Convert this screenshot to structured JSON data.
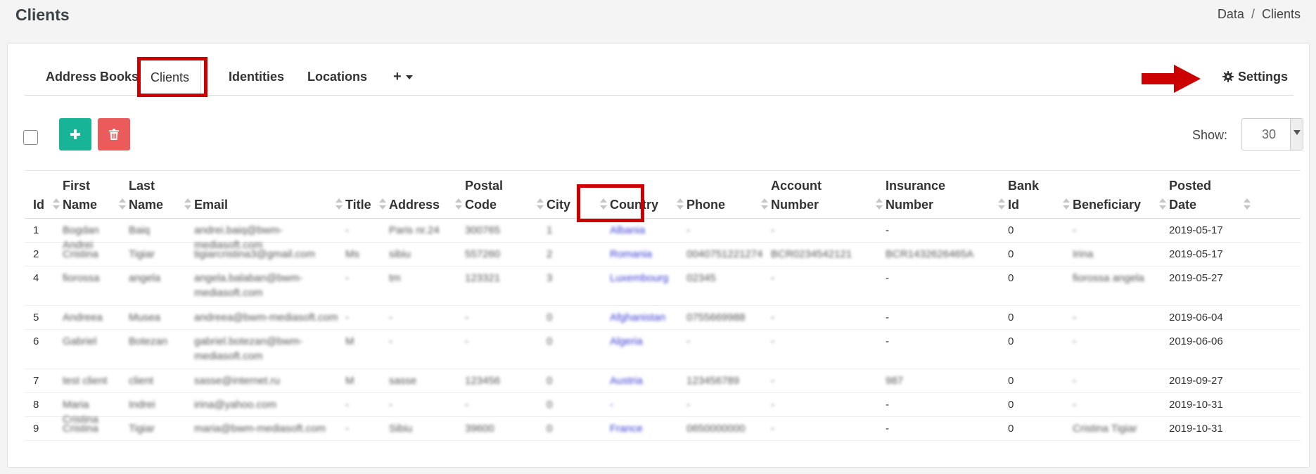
{
  "page": {
    "title": "Clients",
    "breadcrumb": [
      "Data",
      "Clients"
    ],
    "breadcrumb_sep": "/"
  },
  "tabs": [
    {
      "label": "Address Books",
      "active": false
    },
    {
      "label": "Clients",
      "active": true
    },
    {
      "label": "Identities",
      "active": false
    },
    {
      "label": "Locations",
      "active": false
    }
  ],
  "tab_add_label": "+",
  "settings_label": "Settings",
  "toolbar": {
    "show_label": "Show:",
    "show_value": "30"
  },
  "colors": {
    "add_button": "#17b498",
    "delete_button": "#ec5b5b",
    "annotation": "#cc0000",
    "link": "#3b3bd4"
  },
  "table": {
    "columns": [
      {
        "key": "id",
        "label": "Id"
      },
      {
        "key": "first_name",
        "label": "First\nName"
      },
      {
        "key": "last_name",
        "label": "Last\nName"
      },
      {
        "key": "email",
        "label": "Email"
      },
      {
        "key": "title",
        "label": "Title"
      },
      {
        "key": "address",
        "label": "Address"
      },
      {
        "key": "postal_code",
        "label": "Postal\nCode"
      },
      {
        "key": "city",
        "label": "City"
      },
      {
        "key": "country",
        "label": "Country"
      },
      {
        "key": "phone",
        "label": "Phone"
      },
      {
        "key": "account_number",
        "label": "Account\nNumber"
      },
      {
        "key": "insurance_number",
        "label": "Insurance\nNumber"
      },
      {
        "key": "bank_id",
        "label": "Bank\nId"
      },
      {
        "key": "beneficiary",
        "label": "Beneficiary"
      },
      {
        "key": "posted_date",
        "label": "Posted\nDate"
      }
    ],
    "rows": [
      {
        "id": "1",
        "first_name": "Bogdan Andrei",
        "last_name": "Baiq",
        "email": "andrei.baiq@bwm-mediasoft.com",
        "title": "-",
        "address": "Paris nr.24",
        "postal_code": "300765",
        "city": "1",
        "country": "Albania",
        "phone": "-",
        "account_number": "-",
        "insurance_number": "-",
        "bank_id": "0",
        "beneficiary": "-",
        "posted_date": "2019-05-17"
      },
      {
        "id": "2",
        "first_name": "Cristina",
        "last_name": "Tigiar",
        "email": "tigiarcristina3@gmail.com",
        "title": "Ms",
        "address": "sibiu",
        "postal_code": "557260",
        "city": "2",
        "country": "Romania",
        "phone": "0040751221274",
        "account_number": "BCR0234542121",
        "insurance_number": "BCR1432626465A",
        "bank_id": "0",
        "beneficiary": "Irina",
        "posted_date": "2019-05-17"
      },
      {
        "id": "4",
        "first_name": "fiorossa",
        "last_name": "angela",
        "email": "angela.balaban@bwm-mediasoft.com",
        "title": "-",
        "address": "tm",
        "postal_code": "123321",
        "city": "3",
        "country": "Luxembourg",
        "phone": "02345",
        "account_number": "-",
        "insurance_number": "-",
        "bank_id": "0",
        "beneficiary": "fiorossa angela",
        "posted_date": "2019-05-27"
      },
      {
        "id": "5",
        "first_name": "Andreea",
        "last_name": "Musea",
        "email": "andreea@bwm-mediasoft.com",
        "title": "-",
        "address": "-",
        "postal_code": "-",
        "city": "0",
        "country": "Afghanistan",
        "phone": "0755669988",
        "account_number": "-",
        "insurance_number": "-",
        "bank_id": "0",
        "beneficiary": "-",
        "posted_date": "2019-06-04"
      },
      {
        "id": "6",
        "first_name": "Gabriel",
        "last_name": "Botezan",
        "email": "gabriel.botezan@bwm-mediasoft.com",
        "title": "M",
        "address": "-",
        "postal_code": "-",
        "city": "0",
        "country": "Algeria",
        "phone": "-",
        "account_number": "-",
        "insurance_number": "-",
        "bank_id": "0",
        "beneficiary": "-",
        "posted_date": "2019-06-06"
      },
      {
        "id": "7",
        "first_name": "test client",
        "last_name": "client",
        "email": "sasse@internet.ru",
        "title": "M",
        "address": "sasse",
        "postal_code": "123456",
        "city": "0",
        "country": "Austria",
        "phone": "123456789",
        "account_number": "-",
        "insurance_number": "987",
        "bank_id": "0",
        "beneficiary": "-",
        "posted_date": "2019-09-27"
      },
      {
        "id": "8",
        "first_name": "Maria Cristina",
        "last_name": "Indrei",
        "email": "irina@yahoo.com",
        "title": "-",
        "address": "-",
        "postal_code": "-",
        "city": "0",
        "country": "-",
        "phone": "-",
        "account_number": "-",
        "insurance_number": "-",
        "bank_id": "0",
        "beneficiary": "-",
        "posted_date": "2019-10-31"
      },
      {
        "id": "9",
        "first_name": "Cristina",
        "last_name": "Tigiar",
        "email": "maria@bwm-mediasoft.com",
        "title": "-",
        "address": "Sibiu",
        "postal_code": "39600",
        "city": "0",
        "country": "France",
        "phone": "0650000000",
        "account_number": "-",
        "insurance_number": "-",
        "bank_id": "0",
        "beneficiary": "Cristina Tigiar",
        "posted_date": "2019-10-31"
      }
    ]
  }
}
